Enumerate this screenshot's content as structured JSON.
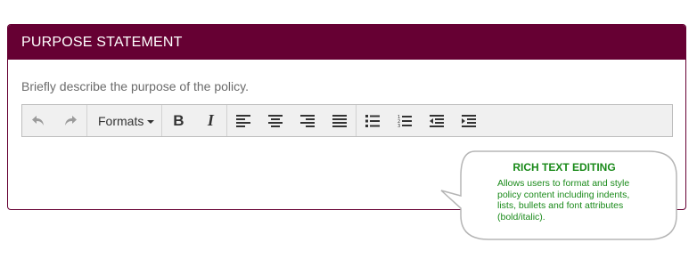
{
  "panel": {
    "title": "PURPOSE STATEMENT",
    "description": "Briefly describe the purpose of the policy.",
    "colors": {
      "header_bg": "#660033",
      "header_text": "#ffffff"
    }
  },
  "toolbar": {
    "undo_icon": "undo-icon",
    "redo_icon": "redo-icon",
    "formats_label": "Formats",
    "bold_label": "B",
    "italic_label": "I",
    "icons": [
      "align-left-icon",
      "align-center-icon",
      "align-right-icon",
      "align-justify-icon",
      "bullet-list-icon",
      "numbered-list-icon",
      "outdent-icon",
      "indent-icon"
    ]
  },
  "callout": {
    "title": "RICH TEXT EDITING",
    "body": "Allows users to format and style policy content including indents, lists, bullets and font attributes (bold/italic).",
    "color": "#1a8a1a"
  }
}
